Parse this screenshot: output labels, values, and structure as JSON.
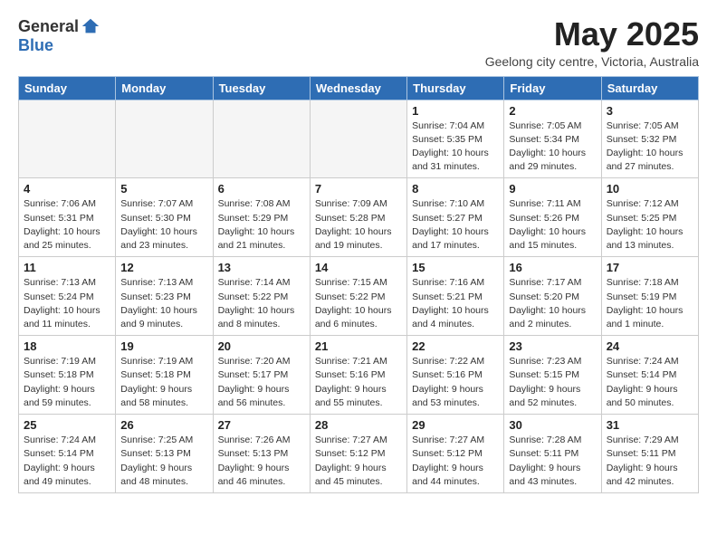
{
  "header": {
    "logo_general": "General",
    "logo_blue": "Blue",
    "month_title": "May 2025",
    "location": "Geelong city centre, Victoria, Australia"
  },
  "days_of_week": [
    "Sunday",
    "Monday",
    "Tuesday",
    "Wednesday",
    "Thursday",
    "Friday",
    "Saturday"
  ],
  "weeks": [
    {
      "row_class": "row1",
      "days": [
        {
          "number": "",
          "info": "",
          "empty": true
        },
        {
          "number": "",
          "info": "",
          "empty": true
        },
        {
          "number": "",
          "info": "",
          "empty": true
        },
        {
          "number": "",
          "info": "",
          "empty": true
        },
        {
          "number": "1",
          "info": "Sunrise: 7:04 AM\nSunset: 5:35 PM\nDaylight: 10 hours\nand 31 minutes.",
          "empty": false
        },
        {
          "number": "2",
          "info": "Sunrise: 7:05 AM\nSunset: 5:34 PM\nDaylight: 10 hours\nand 29 minutes.",
          "empty": false
        },
        {
          "number": "3",
          "info": "Sunrise: 7:05 AM\nSunset: 5:32 PM\nDaylight: 10 hours\nand 27 minutes.",
          "empty": false
        }
      ]
    },
    {
      "row_class": "row2",
      "days": [
        {
          "number": "4",
          "info": "Sunrise: 7:06 AM\nSunset: 5:31 PM\nDaylight: 10 hours\nand 25 minutes.",
          "empty": false
        },
        {
          "number": "5",
          "info": "Sunrise: 7:07 AM\nSunset: 5:30 PM\nDaylight: 10 hours\nand 23 minutes.",
          "empty": false
        },
        {
          "number": "6",
          "info": "Sunrise: 7:08 AM\nSunset: 5:29 PM\nDaylight: 10 hours\nand 21 minutes.",
          "empty": false
        },
        {
          "number": "7",
          "info": "Sunrise: 7:09 AM\nSunset: 5:28 PM\nDaylight: 10 hours\nand 19 minutes.",
          "empty": false
        },
        {
          "number": "8",
          "info": "Sunrise: 7:10 AM\nSunset: 5:27 PM\nDaylight: 10 hours\nand 17 minutes.",
          "empty": false
        },
        {
          "number": "9",
          "info": "Sunrise: 7:11 AM\nSunset: 5:26 PM\nDaylight: 10 hours\nand 15 minutes.",
          "empty": false
        },
        {
          "number": "10",
          "info": "Sunrise: 7:12 AM\nSunset: 5:25 PM\nDaylight: 10 hours\nand 13 minutes.",
          "empty": false
        }
      ]
    },
    {
      "row_class": "row3",
      "days": [
        {
          "number": "11",
          "info": "Sunrise: 7:13 AM\nSunset: 5:24 PM\nDaylight: 10 hours\nand 11 minutes.",
          "empty": false
        },
        {
          "number": "12",
          "info": "Sunrise: 7:13 AM\nSunset: 5:23 PM\nDaylight: 10 hours\nand 9 minutes.",
          "empty": false
        },
        {
          "number": "13",
          "info": "Sunrise: 7:14 AM\nSunset: 5:22 PM\nDaylight: 10 hours\nand 8 minutes.",
          "empty": false
        },
        {
          "number": "14",
          "info": "Sunrise: 7:15 AM\nSunset: 5:22 PM\nDaylight: 10 hours\nand 6 minutes.",
          "empty": false
        },
        {
          "number": "15",
          "info": "Sunrise: 7:16 AM\nSunset: 5:21 PM\nDaylight: 10 hours\nand 4 minutes.",
          "empty": false
        },
        {
          "number": "16",
          "info": "Sunrise: 7:17 AM\nSunset: 5:20 PM\nDaylight: 10 hours\nand 2 minutes.",
          "empty": false
        },
        {
          "number": "17",
          "info": "Sunrise: 7:18 AM\nSunset: 5:19 PM\nDaylight: 10 hours\nand 1 minute.",
          "empty": false
        }
      ]
    },
    {
      "row_class": "row4",
      "days": [
        {
          "number": "18",
          "info": "Sunrise: 7:19 AM\nSunset: 5:18 PM\nDaylight: 9 hours\nand 59 minutes.",
          "empty": false
        },
        {
          "number": "19",
          "info": "Sunrise: 7:19 AM\nSunset: 5:18 PM\nDaylight: 9 hours\nand 58 minutes.",
          "empty": false
        },
        {
          "number": "20",
          "info": "Sunrise: 7:20 AM\nSunset: 5:17 PM\nDaylight: 9 hours\nand 56 minutes.",
          "empty": false
        },
        {
          "number": "21",
          "info": "Sunrise: 7:21 AM\nSunset: 5:16 PM\nDaylight: 9 hours\nand 55 minutes.",
          "empty": false
        },
        {
          "number": "22",
          "info": "Sunrise: 7:22 AM\nSunset: 5:16 PM\nDaylight: 9 hours\nand 53 minutes.",
          "empty": false
        },
        {
          "number": "23",
          "info": "Sunrise: 7:23 AM\nSunset: 5:15 PM\nDaylight: 9 hours\nand 52 minutes.",
          "empty": false
        },
        {
          "number": "24",
          "info": "Sunrise: 7:24 AM\nSunset: 5:14 PM\nDaylight: 9 hours\nand 50 minutes.",
          "empty": false
        }
      ]
    },
    {
      "row_class": "row5",
      "days": [
        {
          "number": "25",
          "info": "Sunrise: 7:24 AM\nSunset: 5:14 PM\nDaylight: 9 hours\nand 49 minutes.",
          "empty": false
        },
        {
          "number": "26",
          "info": "Sunrise: 7:25 AM\nSunset: 5:13 PM\nDaylight: 9 hours\nand 48 minutes.",
          "empty": false
        },
        {
          "number": "27",
          "info": "Sunrise: 7:26 AM\nSunset: 5:13 PM\nDaylight: 9 hours\nand 46 minutes.",
          "empty": false
        },
        {
          "number": "28",
          "info": "Sunrise: 7:27 AM\nSunset: 5:12 PM\nDaylight: 9 hours\nand 45 minutes.",
          "empty": false
        },
        {
          "number": "29",
          "info": "Sunrise: 7:27 AM\nSunset: 5:12 PM\nDaylight: 9 hours\nand 44 minutes.",
          "empty": false
        },
        {
          "number": "30",
          "info": "Sunrise: 7:28 AM\nSunset: 5:11 PM\nDaylight: 9 hours\nand 43 minutes.",
          "empty": false
        },
        {
          "number": "31",
          "info": "Sunrise: 7:29 AM\nSunset: 5:11 PM\nDaylight: 9 hours\nand 42 minutes.",
          "empty": false
        }
      ]
    }
  ]
}
